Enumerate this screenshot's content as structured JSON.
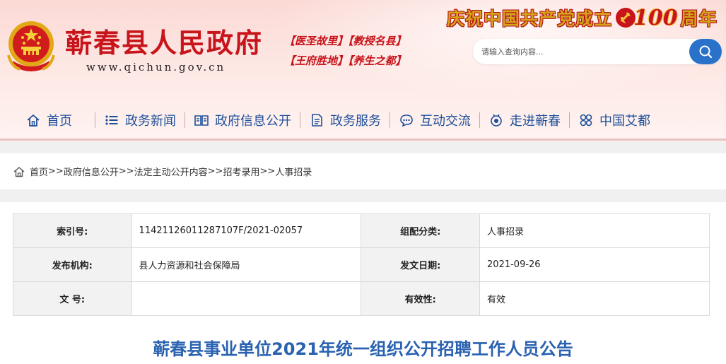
{
  "header": {
    "site_title": "蕲春县人民政府",
    "site_domain": "www.qichun.gov.cn",
    "slogans": [
      "【医圣故里】【教授名县】",
      "【王府胜地】【养生之都】"
    ],
    "anniversary": {
      "prefix": "庆祝中国共产党成立",
      "number": "100",
      "suffix": "周年"
    },
    "search": {
      "placeholder": "请输入查询内容...",
      "button_icon": "search-icon"
    }
  },
  "nav": {
    "items": [
      {
        "label": "首页",
        "icon": "home-icon"
      },
      {
        "label": "政务新闻",
        "icon": "list-icon"
      },
      {
        "label": "政府信息公开",
        "icon": "book-icon"
      },
      {
        "label": "政务服务",
        "icon": "document-icon"
      },
      {
        "label": "互动交流",
        "icon": "chat-icon"
      },
      {
        "label": "走进蕲春",
        "icon": "medal-icon"
      },
      {
        "label": "中国艾都",
        "icon": "grid-icon"
      }
    ]
  },
  "breadcrumb": {
    "icon": "home-icon",
    "items": [
      "首页",
      "政府信息公开",
      "法定主动公开内容",
      "招考录用",
      "人事招录"
    ],
    "separator": ">>"
  },
  "meta": {
    "rows": [
      [
        {
          "label": "索引号:",
          "value": "11421126011287107F/2021-02057"
        },
        {
          "label": "组配分类:",
          "value": "人事招录"
        }
      ],
      [
        {
          "label": "发布机构:",
          "value": "县人力资源和社会保障局"
        },
        {
          "label": "发文日期:",
          "value": "2021-09-26"
        }
      ],
      [
        {
          "label": "文 号:",
          "value": ""
        },
        {
          "label": "有效性:",
          "value": "有效"
        }
      ]
    ]
  },
  "article": {
    "title": "蕲春县事业单位2021年统一组织公开招聘工作人员公告"
  },
  "colors": {
    "brand_red": "#c8141b",
    "nav_blue": "#1e4f9a",
    "title_blue": "#2a62b0",
    "search_blue": "#2a72c9"
  }
}
